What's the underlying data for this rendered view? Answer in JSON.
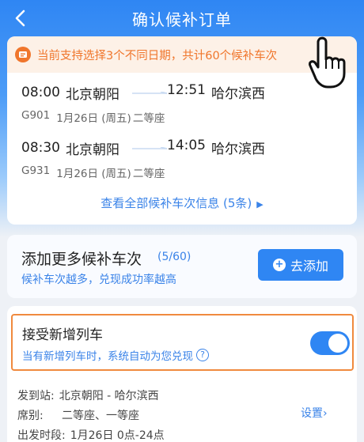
{
  "header": {
    "title": "确认候补订单",
    "back_icon": "chevron-left-icon"
  },
  "notice": {
    "text": "当前支持选择3个不同日期，共计60个候补车次",
    "icon": "ticket-icon",
    "color": "#f0762c"
  },
  "trains": [
    {
      "dep_time": "08:00",
      "dep_station": "北京朝阳",
      "arr_time": "12:51",
      "arr_station": "哈尔滨西",
      "train_no": "G901",
      "date": "1月26日 (周五)",
      "seat": "二等座"
    },
    {
      "dep_time": "08:30",
      "dep_station": "北京朝阳",
      "arr_time": "14:05",
      "arr_station": "哈尔滨西",
      "train_no": "G931",
      "date": "1月26日 (周五)",
      "seat": "二等座"
    }
  ],
  "view_all": {
    "label": "查看全部候补车次信息 (5条)",
    "arrow": "▶"
  },
  "add_more": {
    "title": "添加更多候补车次",
    "count": "(5/60)",
    "subtitle": "候补车次越多，兑现成功率越高",
    "button_label": "去添加",
    "button_icon": "plus-icon"
  },
  "accept_new": {
    "title": "接受新增列车",
    "subtitle": "当有新增列车时，系统自动为您兑现",
    "help_icon": "?",
    "toggle_on": true
  },
  "details": {
    "route_label": "发到站:",
    "route_value": "北京朝阳 - 哈尔滨西",
    "seat_label": "席别:",
    "seat_value": "二等座、一等座",
    "time_label": "出发时段:",
    "time_value": "1月26日 0点-24点",
    "settings_label": "设置"
  },
  "colors": {
    "accent": "#2f86f3",
    "link": "#3a83e8",
    "highlight": "#f08a3e"
  }
}
